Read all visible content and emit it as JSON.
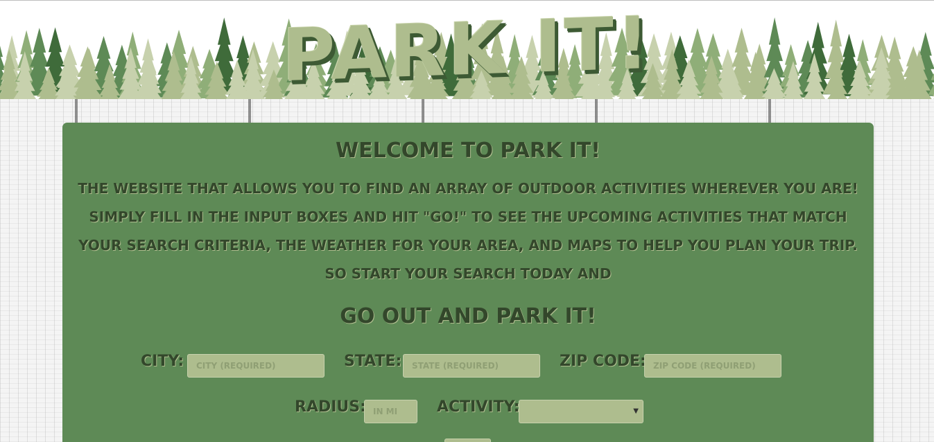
{
  "header": {
    "title": "PARK IT!"
  },
  "main": {
    "welcome_title": "WELCOME TO PARK IT!",
    "intro_lines": [
      "THE WEBSITE THAT ALLOWS YOU TO FIND AN ARRAY OF OUTDOOR ACTIVITIES WHEREVER YOU ARE!",
      "SIMPLY FILL IN THE INPUT BOXES AND HIT \"GO!\" TO SEE THE UPCOMING ACTIVITIES THAT MATCH",
      "YOUR SEARCH CRITERIA, THE WEATHER FOR YOUR AREA, AND MAPS TO HELP YOU PLAN YOUR TRIP.",
      "SO START YOUR SEARCH TODAY AND"
    ],
    "tagline": "GO OUT AND PARK IT!"
  },
  "form": {
    "city": {
      "label": "CITY:",
      "placeholder": "CITY (REQUIRED)",
      "value": ""
    },
    "state": {
      "label": "STATE:",
      "placeholder": "STATE (REQUIRED)",
      "value": ""
    },
    "zip": {
      "label": "ZIP CODE:",
      "placeholder": "ZIP CODE (REQUIRED)",
      "value": ""
    },
    "radius": {
      "label": "RADIUS:",
      "placeholder": "IN MI",
      "value": ""
    },
    "activity": {
      "label": "ACTIVITY:",
      "selected": ""
    },
    "go_label": ""
  },
  "colors": {
    "panel": "#5e8a56",
    "input": "#aebd8e",
    "text": "#33472b",
    "title": "#aebd8e"
  },
  "icons": {
    "select_arrow": "chevron-down-icon"
  }
}
